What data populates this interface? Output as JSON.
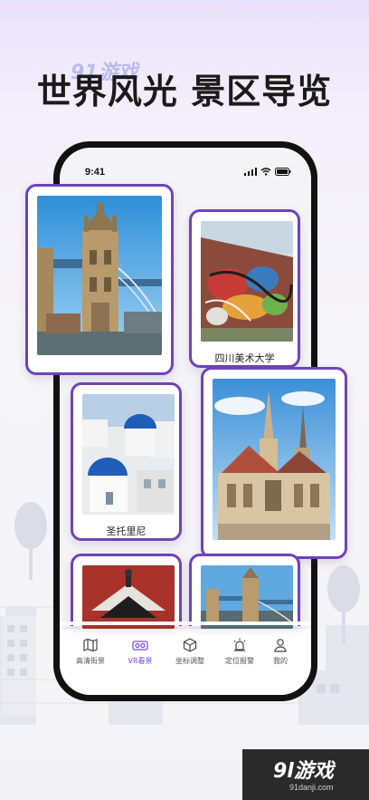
{
  "headline": "世界风光 景区导览",
  "watermark": {
    "top_logo": "91游戏",
    "bottom_logo": "9l游戏",
    "bottom_url": "91danji.com"
  },
  "status_bar": {
    "time": "9:41"
  },
  "cards": [
    {
      "name": "tower-bridge-photo",
      "caption": ""
    },
    {
      "name": "graffiti-wall-photo",
      "caption": "四川美术大学"
    },
    {
      "name": "santorini-photo",
      "caption": "圣托里尼"
    },
    {
      "name": "cathedral-photo",
      "caption": ""
    },
    {
      "name": "pagoda-roof-photo",
      "caption": ""
    },
    {
      "name": "tower-bridge-small-photo",
      "caption": ""
    }
  ],
  "tabs": [
    {
      "label": "高清街景",
      "icon": "map-icon",
      "active": false
    },
    {
      "label": "VR看景",
      "icon": "vr-goggles-icon",
      "active": true
    },
    {
      "label": "坐标调整",
      "icon": "cube-icon",
      "active": false
    },
    {
      "label": "定位报警",
      "icon": "alarm-light-icon",
      "active": false
    },
    {
      "label": "我的",
      "icon": "user-icon",
      "active": false
    }
  ],
  "colors": {
    "accent": "#6f43b8",
    "active_tab": "#7a4bd6",
    "headline": "#1a1a1a"
  }
}
